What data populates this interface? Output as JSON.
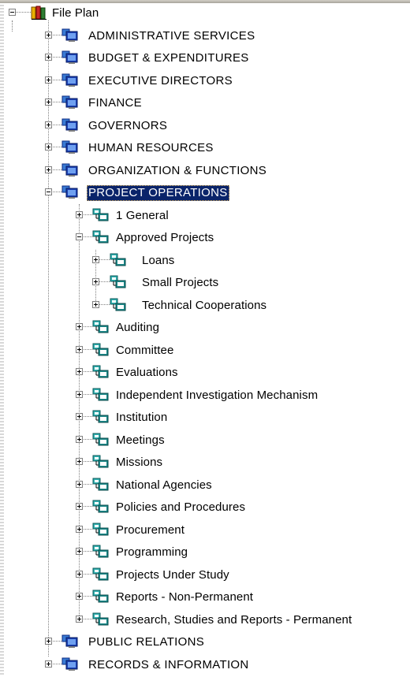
{
  "tree": {
    "root": {
      "label": "File Plan",
      "icon": "books-icon",
      "expanded": true
    },
    "level1": [
      {
        "label": "ADMINISTRATIVE SERVICES",
        "expanded": false
      },
      {
        "label": "BUDGET & EXPENDITURES",
        "expanded": false
      },
      {
        "label": "EXECUTIVE DIRECTORS",
        "expanded": false
      },
      {
        "label": "FINANCE",
        "expanded": false
      },
      {
        "label": "GOVERNORS",
        "expanded": false
      },
      {
        "label": "HUMAN RESOURCES",
        "expanded": false
      },
      {
        "label": "ORGANIZATION & FUNCTIONS",
        "expanded": false
      },
      {
        "label": "PROJECT OPERATIONS",
        "expanded": true,
        "selected": true
      },
      {
        "label": "PUBLIC RELATIONS",
        "expanded": false
      },
      {
        "label": "RECORDS & INFORMATION",
        "expanded": false
      }
    ],
    "project_operations_children": [
      {
        "label": "1 General",
        "expanded": false
      },
      {
        "label": "Approved Projects",
        "expanded": true
      },
      {
        "label": "Auditing",
        "expanded": false
      },
      {
        "label": "Committee",
        "expanded": false
      },
      {
        "label": "Evaluations",
        "expanded": false
      },
      {
        "label": "Independent Investigation Mechanism",
        "expanded": false
      },
      {
        "label": "Institution",
        "expanded": false
      },
      {
        "label": "Meetings",
        "expanded": false
      },
      {
        "label": "Missions",
        "expanded": false
      },
      {
        "label": "National Agencies",
        "expanded": false
      },
      {
        "label": "Policies and Procedures",
        "expanded": false
      },
      {
        "label": "Procurement",
        "expanded": false
      },
      {
        "label": "Programming",
        "expanded": false
      },
      {
        "label": "Projects Under Study",
        "expanded": false
      },
      {
        "label": "Reports - Non-Permanent",
        "expanded": false
      },
      {
        "label": "Research, Studies and Reports - Permanent",
        "expanded": false
      }
    ],
    "approved_projects_children": [
      {
        "label": "Loans",
        "expanded": false
      },
      {
        "label": "Small Projects",
        "expanded": false
      },
      {
        "label": "Technical Cooperations",
        "expanded": false
      }
    ]
  },
  "colors": {
    "selection_bg": "#0a246a",
    "selection_text": "#ffffff",
    "computer_icon": "#1a3fb0",
    "network_icon": "#1c8a8a"
  }
}
